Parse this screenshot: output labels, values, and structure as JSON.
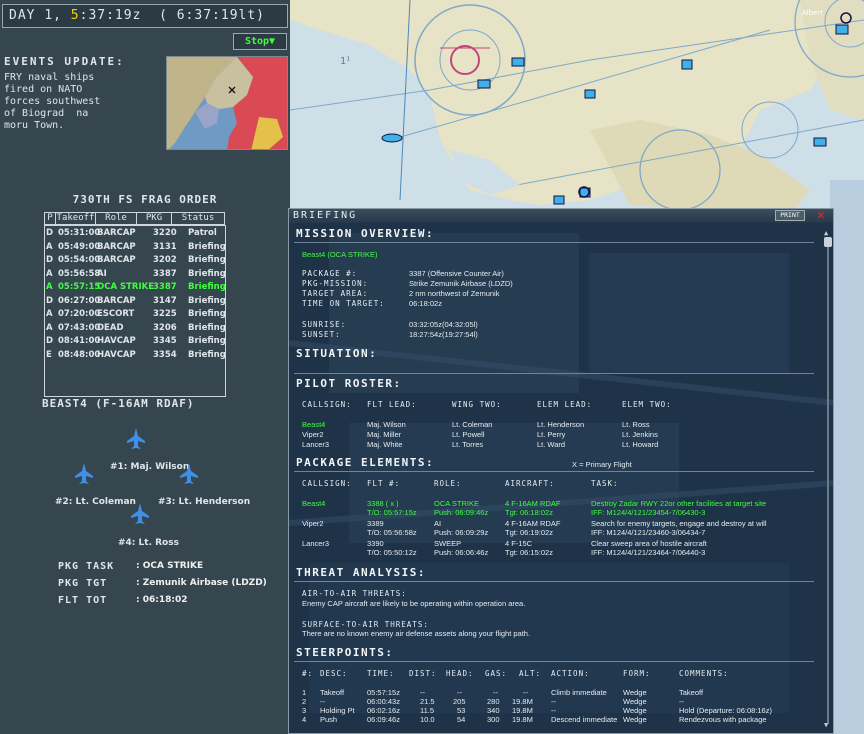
{
  "clock": {
    "label": "Day",
    "day": "1,",
    "hour": "5",
    "rest": ":37:19z",
    "local": "( 6:37:19lt)"
  },
  "stop_label": "Stop▼",
  "events": {
    "title": "Events Update:",
    "text": "FRY naval ships\nfired on NATO\nforces southwest\nof Biograd  na\nmoru Town."
  },
  "frag": {
    "title": "730th FS Frag Order",
    "headers": [
      "P",
      "Takeoff",
      "Role",
      "PKG",
      "Status"
    ],
    "rows": [
      {
        "p": "D",
        "takeoff": "05:31:00",
        "role": "BARCAP",
        "pkg": "3220",
        "status": "Patrol"
      },
      {
        "p": "A",
        "takeoff": "05:49:00",
        "role": "BARCAP",
        "pkg": "3131",
        "status": "Briefing"
      },
      {
        "p": "D",
        "takeoff": "05:54:00",
        "role": "BARCAP",
        "pkg": "3202",
        "status": "Briefing"
      },
      {
        "p": "A",
        "takeoff": "05:56:58",
        "role": "AI",
        "pkg": "3387",
        "status": "Briefing"
      },
      {
        "p": "A",
        "takeoff": "05:57:15",
        "role": "OCA STRIKE",
        "pkg": "3387",
        "status": "Briefing",
        "selected": true
      },
      {
        "p": "D",
        "takeoff": "06:27:00",
        "role": "BARCAP",
        "pkg": "3147",
        "status": "Briefing"
      },
      {
        "p": "A",
        "takeoff": "07:20:00",
        "role": "ESCORT",
        "pkg": "3225",
        "status": "Briefing"
      },
      {
        "p": "A",
        "takeoff": "07:43:00",
        "role": "DEAD",
        "pkg": "3206",
        "status": "Briefing"
      },
      {
        "p": "D",
        "takeoff": "08:41:00",
        "role": "HAVCAP",
        "pkg": "3345",
        "status": "Briefing"
      },
      {
        "p": "E",
        "takeoff": "08:48:00",
        "role": "HAVCAP",
        "pkg": "3354",
        "status": "Briefing"
      }
    ]
  },
  "flight": {
    "title": "Beast4 (F-16AM RDAF)",
    "pilot1": "#1: Maj. Wilson",
    "pilot2": "#2: Lt. Coleman",
    "pilot3": "#3: Lt. Henderson",
    "pilot4": "#4: Lt. Ross",
    "pkg_task_label": "Pkg Task",
    "pkg_task": ": OCA STRIKE",
    "pkg_tgt_label": "Pkg TGT",
    "pkg_tgt": ": Zemunik Airbase (LDZD)",
    "flt_tot_label": "Flt TOT",
    "flt_tot": ": 06:18:02"
  },
  "map_labels": {
    "grid1": "1¹",
    "label_right": "Albert"
  },
  "briefing": {
    "title": "Briefing",
    "print": "PRINT",
    "close": "✕",
    "overview_title": "Mission Overview:",
    "flight_name": "Beast4 (OCA STRIKE)",
    "package_label": "Package #:",
    "package": "3387 (Offensive Counter Air)",
    "pkg_mission_label": "Pkg-Mission:",
    "pkg_mission": "Strike Zemunik Airbase (LDZD)",
    "target_area_label": "Target Area:",
    "target_area": "2 nm northwest of Zemunik",
    "tot_label": "Time on Target:",
    "tot": "06:18:02z",
    "sunrise_label": "Sunrise:",
    "sunrise": "03:32:05z(04:32:05l)",
    "sunset_label": "Sunset:",
    "sunset": "18:27:54z(19:27:54l)",
    "situation_title": "Situation:",
    "roster_title": "Pilot Roster:",
    "roster_headers": [
      "Callsign:",
      "Flt Lead:",
      "Wing Two:",
      "Elem Lead:",
      "Elem Two:"
    ],
    "roster": [
      {
        "callsign": "Beast4",
        "lead": "Maj. Wilson",
        "wing": "Lt. Coleman",
        "elem_lead": "Lt. Henderson",
        "elem_two": "Lt. Ross",
        "own": true
      },
      {
        "callsign": "Viper2",
        "lead": "Maj. Miller",
        "wing": "Lt. Powell",
        "elem_lead": "Lt. Perry",
        "elem_two": "Lt. Jenkins"
      },
      {
        "callsign": "Lancer3",
        "lead": "Maj. White",
        "wing": "Lt. Torres",
        "elem_lead": "Lt. Ward",
        "elem_two": "Lt. Howard"
      }
    ],
    "elements_title": "Package Elements:",
    "primary_note": "X = Primary Flight",
    "element_headers": [
      "Callsign:",
      "Flt #:",
      "Role:",
      "Aircraft:",
      "Task:"
    ],
    "elements": [
      {
        "callsign": "Beast4",
        "flt": "3388 ( x )",
        "to": "T/O: 05:57:15z",
        "role": "OCA STRIKE",
        "push": "Push: 06:09:46z",
        "aircraft": "4 F-16AM RDAF",
        "tgt": "Tgt: 06:18:02z",
        "task": "Destroy Zadar RWY 22or other facilities at target site",
        "iff": "IFF: M124/4/121/23454-7/06430-3",
        "own": true
      },
      {
        "callsign": "Viper2",
        "flt": "3389",
        "to": "T/O: 05:56:58z",
        "role": "AI",
        "push": "Push: 06:09:29z",
        "aircraft": "4 F-16AM RDAF",
        "tgt": "Tgt: 06:19:02z",
        "task": "Search for enemy targets, engage and destroy at will",
        "iff": "IFF: M124/4/121/23460-3/06434-7"
      },
      {
        "callsign": "Lancer3",
        "flt": "3390",
        "to": "T/O: 05:50:12z",
        "role": "SWEEP",
        "push": "Push: 06:06:46z",
        "aircraft": "4 F-15C",
        "tgt": "Tgt: 06:15:02z",
        "task": "Clear sweep area of hostile aircraft",
        "iff": "IFF: M124/4/121/23464-7/06440-3"
      }
    ],
    "threat_title": "Threat Analysis:",
    "air_threat_label": "Air-to-Air Threats:",
    "air_threat": "Enemy CAP aircraft are likely to be operating within operation area.",
    "sam_threat_label": "Surface-to-Air Threats:",
    "sam_threat": "There are no known enemy air defense assets along your flight path.",
    "steer_title": "Steerpoints:",
    "steer_headers": [
      "#:",
      "Desc:",
      "Time:",
      "Dist:",
      "Head:",
      "Gas:",
      "Alt:",
      "Action:",
      "Form:",
      "Comments:"
    ],
    "steerpoints": [
      {
        "n": "1",
        "desc": "Takeoff",
        "time": "05:57:15z",
        "dist": "--",
        "head": "--",
        "gas": "--",
        "alt": "--",
        "action": "Climb immediate",
        "form": "Wedge",
        "comment": "Takeoff"
      },
      {
        "n": "2",
        "desc": "--",
        "time": "06:00:43z",
        "dist": "21.5",
        "head": "205",
        "gas": "280",
        "alt": "19.8M",
        "action": "--",
        "form": "Wedge",
        "comment": "--"
      },
      {
        "n": "3",
        "desc": "Holding Pt",
        "time": "06:02:16z",
        "dist": "11.5",
        "head": "53",
        "gas": "340",
        "alt": "19.8M",
        "action": "--",
        "form": "Wedge",
        "comment": "Hold  (Departure: 06:08:16z)"
      },
      {
        "n": "4",
        "desc": "Push",
        "time": "06:09:46z",
        "dist": "10.0",
        "head": "54",
        "gas": "300",
        "alt": "19.8M",
        "action": "Descend immediate",
        "form": "Wedge",
        "comment": "Rendezvous with package"
      }
    ]
  },
  "colors": {
    "accent_green": "#3cff3c",
    "clock_yellow": "#f5d400",
    "close_red": "#ff2020"
  }
}
